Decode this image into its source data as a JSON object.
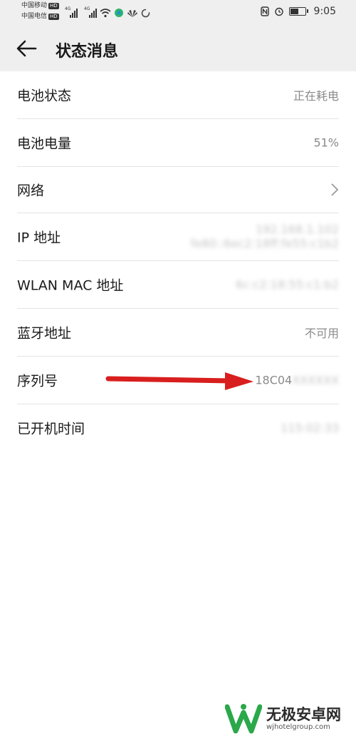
{
  "status_bar": {
    "carrier1": "中国移动",
    "carrier2": "中国电信",
    "hd_badge": "HD",
    "network_type": "4G",
    "time": "9:05",
    "icons": [
      "signal-icon",
      "wifi-icon",
      "app-icon",
      "huawei-icon",
      "sync-icon",
      "nfc-icon",
      "alarm-icon",
      "battery-icon"
    ]
  },
  "app_bar": {
    "title": "状态消息",
    "back_icon": "arrow-left-icon"
  },
  "rows": [
    {
      "label": "电池状态",
      "value": "正在耗电"
    },
    {
      "label": "电池电量",
      "value": "51%"
    },
    {
      "label": "网络",
      "value": "",
      "chevron": "chevron-right-icon"
    },
    {
      "label": "IP 地址",
      "value": "192.168.1.102",
      "value2": "fe80::6ec2:18ff:fe55:c1b2"
    },
    {
      "label": "WLAN MAC 地址",
      "value": "6c:c2:18:55:c1:b2"
    },
    {
      "label": "蓝牙地址",
      "value": "不可用"
    },
    {
      "label": "序列号",
      "value": "18C04",
      "value_blurred": "XXXXXX"
    },
    {
      "label": "已开机时间",
      "value": "115:02:33"
    }
  ],
  "annotation": {
    "type": "arrow",
    "color": "#e02020"
  },
  "watermark": {
    "name": "无极安卓网",
    "url": "wjhotelgroup.com"
  }
}
